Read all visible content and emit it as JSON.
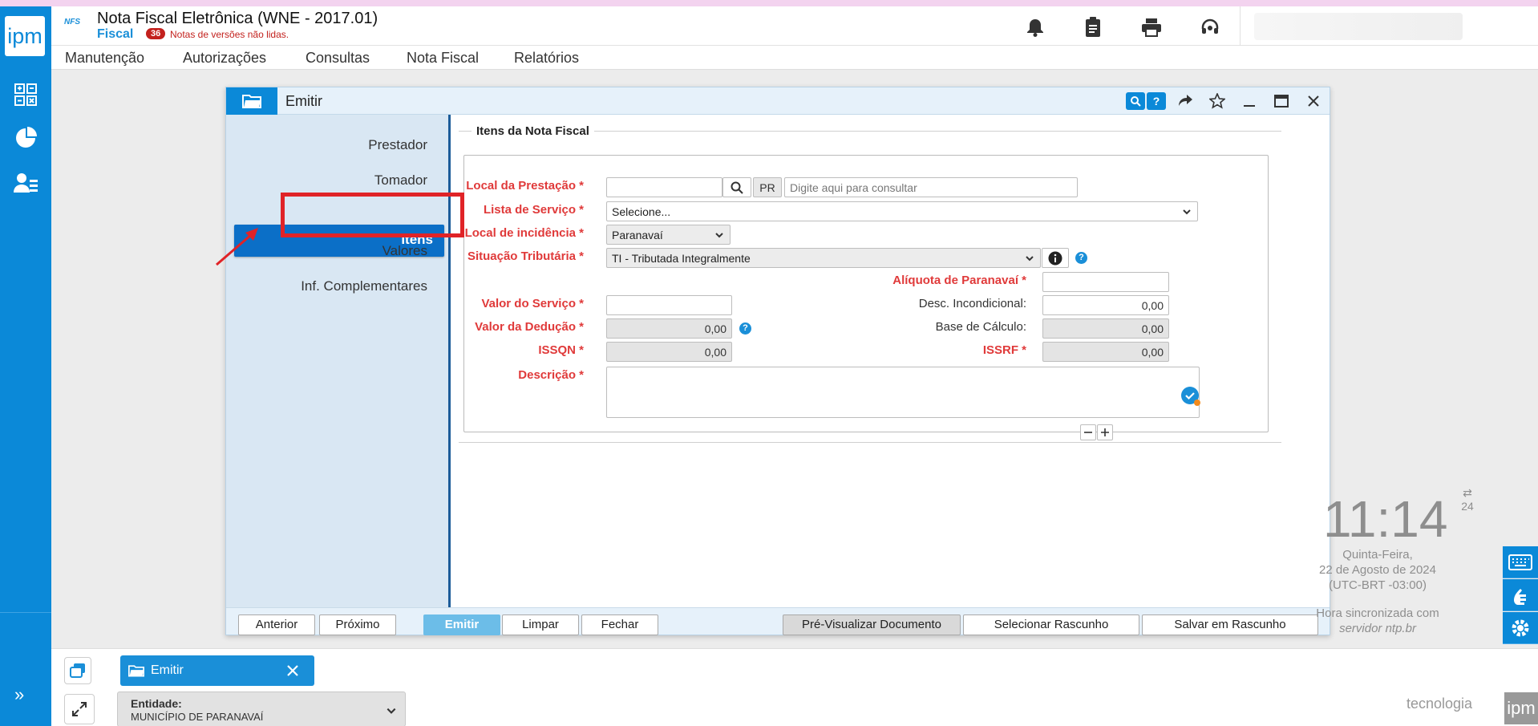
{
  "app": {
    "logo_text": "ipm",
    "brand_mark": "NFS",
    "title": "Nota Fiscal Eletrônica (WNE - 2017.01)",
    "module": "Fiscal",
    "badge_count": "36",
    "notice": "Notas de versões não lidas."
  },
  "menu": [
    "Manutenção",
    "Autorizações",
    "Consultas",
    "Nota Fiscal",
    "Relatórios"
  ],
  "dialog": {
    "title": "Emitir",
    "side_items": {
      "prestador": "Prestador",
      "tomador": "Tomador",
      "itens": "Itens",
      "valores": "Valores",
      "inf": "Inf. Complementares"
    },
    "section_title": "Itens da Nota Fiscal",
    "fields": {
      "local_prestacao_label": "Local da Prestação *",
      "local_prestacao_uf": "PR",
      "local_prestacao_placeholder": "Digite aqui para consultar",
      "lista_servico_label": "Lista de Serviço *",
      "lista_servico_value": "Selecione...",
      "local_incidencia_label": "Local de incidência *",
      "local_incidencia_value": "Paranavaí",
      "situacao_label": "Situação Tributária *",
      "situacao_value": "TI - Tributada Integralmente",
      "aliquota_label": "Alíquota de Paranavaí *",
      "valor_servico_label": "Valor do Serviço *",
      "desc_incond_label": "Desc. Incondicional:",
      "desc_incond_value": "0,00",
      "valor_deducao_label": "Valor da Dedução *",
      "valor_deducao_value": "0,00",
      "base_calculo_label": "Base de Cálculo:",
      "base_calculo_value": "0,00",
      "issqn_label": "ISSQN *",
      "issqn_value": "0,00",
      "issrf_label": "ISSRF *",
      "issrf_value": "0,00",
      "descricao_label": "Descrição *"
    },
    "buttons": {
      "anterior": "Anterior",
      "proximo": "Próximo",
      "emitir": "Emitir",
      "limpar": "Limpar",
      "fechar": "Fechar",
      "pre_visualizar": "Pré-Visualizar Documento",
      "selecionar_rascunho": "Selecionar Rascunho",
      "salvar_rascunho": "Salvar em Rascunho"
    }
  },
  "clock": {
    "time": "11:14",
    "format": "24",
    "weekday": "Quinta-Feira,",
    "date": "22 de Agosto de 2024",
    "tz": "(UTC-BRT -03:00)",
    "sync_line1": "Hora sincronizada com",
    "sync_line2": "servidor ntp.br"
  },
  "taskbar": {
    "tab_label": "Emitir",
    "entidade_label": "Entidade:",
    "entidade_value": "MUNICÍPIO DE PARANAVAÍ",
    "footer_brand": "tecnologia",
    "footer_logo": "ipm"
  },
  "colors": {
    "primary": "#0b89d8",
    "required": "#e03a3a",
    "annotation": "#e02327"
  }
}
